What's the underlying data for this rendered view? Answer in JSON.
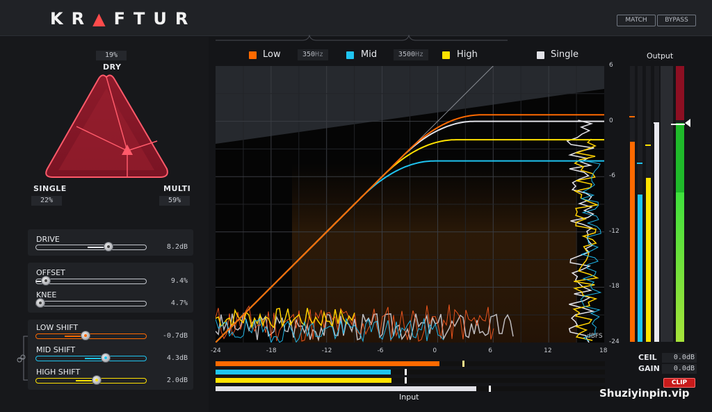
{
  "header": {
    "logo": [
      "K",
      "R",
      "A",
      "F",
      "T",
      "U",
      "R"
    ],
    "match_label": "MATCH",
    "bypass_label": "BYPASS"
  },
  "triangle": {
    "dry_label": "DRY",
    "dry_value": "19%",
    "single_label": "SINGLE",
    "single_value": "22%",
    "multi_label": "MULTI",
    "multi_value": "59%"
  },
  "controls": {
    "drive": {
      "label": "DRIVE",
      "value": "8.2dB",
      "position": 0.66
    },
    "offset": {
      "label": "OFFSET",
      "value": "9.4%",
      "position": 0.09
    },
    "knee": {
      "label": "KNEE",
      "value": "4.7%",
      "position": 0.04
    },
    "low_shift": {
      "label": "LOW SHIFT",
      "value": "-0.7dB",
      "position": 0.45
    },
    "mid_shift": {
      "label": "MID SHIFT",
      "value": "4.3dB",
      "position": 0.63
    },
    "high_shift": {
      "label": "HIGH SHIFT",
      "value": "2.0dB",
      "position": 0.55
    }
  },
  "legend": {
    "low": "Low",
    "low_color": "#ff6a00",
    "low_mid_freq": "350",
    "mid": "Mid",
    "mid_color": "#1fc4f0",
    "mid_high_freq": "3500",
    "high": "High",
    "high_color": "#ffe200",
    "single": "Single",
    "single_color": "#e2e2e8",
    "hz": "Hz"
  },
  "graph": {
    "x_ticks": [
      "-24",
      "-18",
      "-12",
      "-6",
      "0",
      "6",
      "12",
      "18"
    ],
    "y_ticks": [
      "6",
      "0",
      "-6",
      "-12",
      "-18",
      "-24"
    ],
    "range_db": [
      -24,
      18
    ],
    "y_range_db": [
      -24,
      6
    ],
    "unit": "dBFS",
    "x_title": "Input",
    "ceilings_db": {
      "low": 0.7,
      "single": 0.0,
      "high": -2.0,
      "mid": -4.3
    }
  },
  "input_meters": [
    {
      "name": "low",
      "level_db": 0.2,
      "peak_db": 2.7,
      "color": "#ff6a00"
    },
    {
      "name": "mid",
      "level_db": -5.1,
      "peak_db": -3.6,
      "color": "#1fc4f0"
    },
    {
      "name": "high",
      "level_db": -5.0,
      "peak_db": -3.6,
      "color": "#ffe200"
    },
    {
      "name": "single",
      "level_db": 4.2,
      "peak_db": 5.5,
      "color": "#e2e2e8"
    }
  ],
  "output": {
    "title": "Output",
    "meters": [
      {
        "name": "low",
        "level_db": -2.3,
        "peak_db": 0.6,
        "color": "#ff6a00"
      },
      {
        "name": "mid",
        "level_db": -8.0,
        "peak_db": -4.5,
        "color": "#1fc4f0"
      },
      {
        "name": "high",
        "level_db": -6.2,
        "peak_db": -2.5,
        "color": "#ffe200"
      },
      {
        "name": "single",
        "level_db": -0.3,
        "peak_db": -0.1,
        "color": "#e8e8ee"
      }
    ],
    "ceil_label": "CEIL",
    "ceil_value": "0.0dB",
    "gain_label": "GAIN",
    "gain_value": "0.0dB",
    "clip_label": "CLIP"
  },
  "watermark": "Shuziyinpin.vip"
}
